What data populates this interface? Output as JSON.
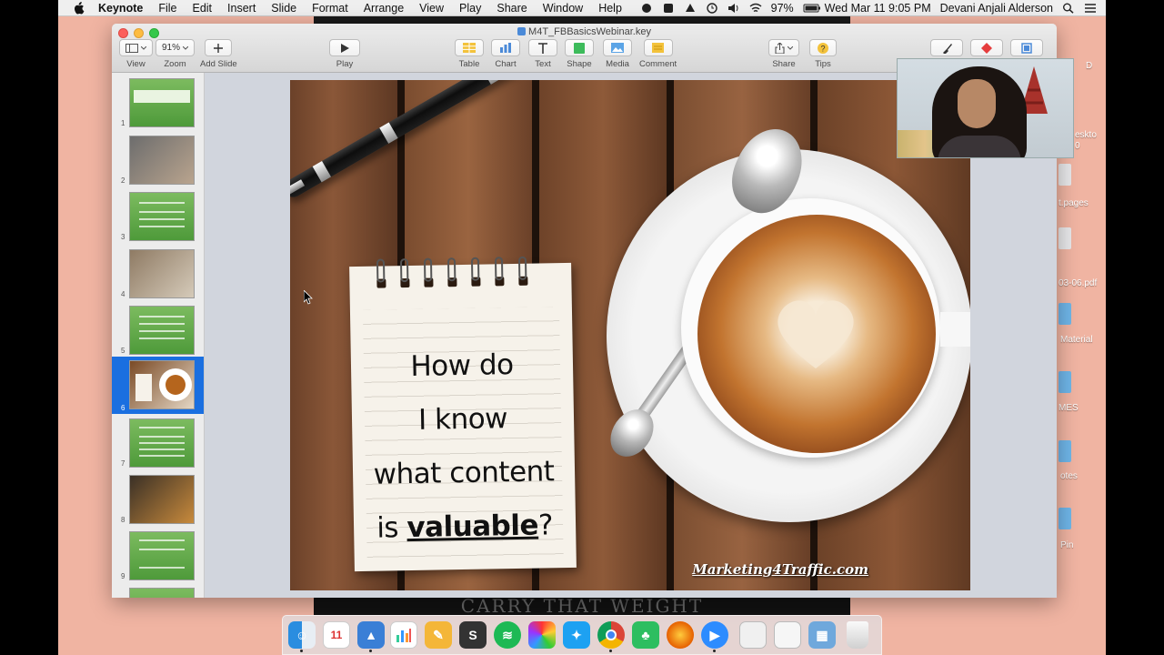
{
  "menubar": {
    "app_name": "Keynote",
    "items": [
      "File",
      "Edit",
      "Insert",
      "Slide",
      "Format",
      "Arrange",
      "View",
      "Play",
      "Share",
      "Window",
      "Help"
    ],
    "battery": "97%",
    "clock": "Wed Mar 11  9:05 PM",
    "user": "Devani Anjali Alderson"
  },
  "window": {
    "document_title": "M4T_FBBasicsWebinar.key",
    "toolbar": {
      "view_label": "View",
      "zoom_value": "91%",
      "zoom_label": "Zoom",
      "add_slide_label": "Add Slide",
      "play_label": "Play",
      "table_label": "Table",
      "chart_label": "Chart",
      "text_label": "Text",
      "shape_label": "Shape",
      "media_label": "Media",
      "comment_label": "Comment",
      "share_label": "Share",
      "tips_label": "Tips"
    }
  },
  "navigator": {
    "slides": [
      {
        "number": "1",
        "style": "green-title"
      },
      {
        "number": "2",
        "style": "photo-person"
      },
      {
        "number": "3",
        "style": "green-list"
      },
      {
        "number": "4",
        "style": "photo-laptop"
      },
      {
        "number": "5",
        "style": "green-list"
      },
      {
        "number": "6",
        "style": "photo-coffee",
        "selected": true
      },
      {
        "number": "7",
        "style": "green-list"
      },
      {
        "number": "8",
        "style": "photo-clock"
      },
      {
        "number": "9",
        "style": "green-list"
      }
    ]
  },
  "slide": {
    "line1": "How do",
    "line2": "I know",
    "line3": "what content",
    "line4_prefix": "is ",
    "line4_emphasis": "valuable",
    "line4_suffix": "?",
    "watermark": "Marketing4Traffic.com"
  },
  "background": {
    "video_caption": "CARRY THAT WEIGHT"
  },
  "desktop": {
    "labels": [
      "D",
      "eskto",
      "0",
      "t.pages",
      "03-06.pdf",
      "Material",
      "MES",
      "otes",
      "Pin"
    ]
  },
  "colors": {
    "desktop_bg": "#f0b4a2",
    "selection": "#1a6fe0",
    "slide_green": "#5ea844"
  }
}
